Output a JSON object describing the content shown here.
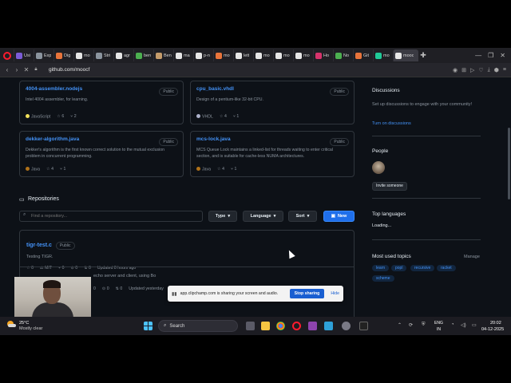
{
  "browser": {
    "tabs": [
      {
        "label": "Usi",
        "color": "#7b5cd6"
      },
      {
        "label": "Exp",
        "color": "#8b949e"
      },
      {
        "label": "Dig",
        "color": "#e8743b"
      },
      {
        "label": "mo",
        "color": "#e6e6e6"
      },
      {
        "label": "Stri",
        "color": "#8b949e"
      },
      {
        "label": "agr",
        "color": "#e6e6e6"
      },
      {
        "label": "ben",
        "color": "#4caf50"
      },
      {
        "label": "Ben",
        "color": "#c59c6b"
      },
      {
        "label": "ma",
        "color": "#e6e6e6"
      },
      {
        "label": "p-n",
        "color": "#e6e6e6"
      },
      {
        "label": "mo",
        "color": "#e8743b"
      },
      {
        "label": "lett",
        "color": "#e6e6e6"
      },
      {
        "label": "mo",
        "color": "#e6e6e6"
      },
      {
        "label": "mo",
        "color": "#e6e6e6"
      },
      {
        "label": "mo",
        "color": "#e6e6e6"
      },
      {
        "label": "Ho",
        "color": "#d6336c"
      },
      {
        "label": "No",
        "color": "#4caf50"
      },
      {
        "label": "Git",
        "color": "#e8743b"
      },
      {
        "label": "mo",
        "color": "#20c997"
      }
    ],
    "active_tab": "mooc",
    "url": "github.com/moocf"
  },
  "cards": [
    {
      "title": "4004-assembler.nodejs",
      "badge": "Public",
      "desc": "Intel 4004 assembler, for learning.",
      "lang": "JavaScript",
      "lang_color": "#f1e05a",
      "stars": "6",
      "forks": "2"
    },
    {
      "title": "cpu_basic.vhdl",
      "badge": "Public",
      "desc": "Design of a pentium-like 32-bit CPU.",
      "lang": "VHDL",
      "lang_color": "#adb2cb",
      "stars": "4",
      "forks": "1"
    },
    {
      "title": "dekker-algorithm.java",
      "badge": "Public",
      "desc": "Dekker's algorithm is the first known correct solution to the mutual exclusion problem in concurrent programming.",
      "lang": "Java",
      "lang_color": "#b07219",
      "stars": "4",
      "forks": "1"
    },
    {
      "title": "mcs-lock.java",
      "badge": "Public",
      "desc": "MCS Queue Lock maintains a linked-list for threads waiting to enter critical section, and is suitable for cache-less NUMA architectures.",
      "lang": "Java",
      "lang_color": "#b07219",
      "stars": "4",
      "forks": "1"
    }
  ],
  "repositories": {
    "heading": "Repositories",
    "search_placeholder": "Find a repository...",
    "type_label": "Type",
    "language_label": "Language",
    "sort_label": "Sort",
    "new_label": "New",
    "items": [
      {
        "name": "tigr-test.c",
        "badge": "Public",
        "desc": "Testing TIGR.",
        "stars": "0",
        "license": "MIT",
        "forks": "0",
        "issues": "0",
        "prs": "0",
        "updated": "Updated 8 hours ago"
      },
      {
        "desc": "echo server and client, using Bo",
        "stars": "0",
        "issues": "0",
        "prs": "0",
        "updated": "Updated yesterday"
      }
    ]
  },
  "sidebar": {
    "discussions_heading": "Discussions",
    "discussions_text": "Set up discussions to engage with your community!",
    "discussions_link": "Turn on discussions",
    "people_heading": "People",
    "invite_label": "Invite someone",
    "languages_heading": "Top languages",
    "languages_status": "Loading...",
    "topics_heading": "Most used topics",
    "manage_label": "Manage",
    "topics": [
      "learn",
      "popl",
      "recursive",
      "racket",
      "scheme"
    ]
  },
  "share_banner": {
    "text": "app.clipchamp.com is sharing your screen and audio.",
    "stop_label": "Stop sharing",
    "hide_label": "Hide"
  },
  "taskbar": {
    "temperature": "25°C",
    "weather": "Mostly clear",
    "search_label": "Search",
    "lang1": "ENG",
    "lang2": "IN",
    "time": "20:02",
    "date": "04-12-2025"
  }
}
